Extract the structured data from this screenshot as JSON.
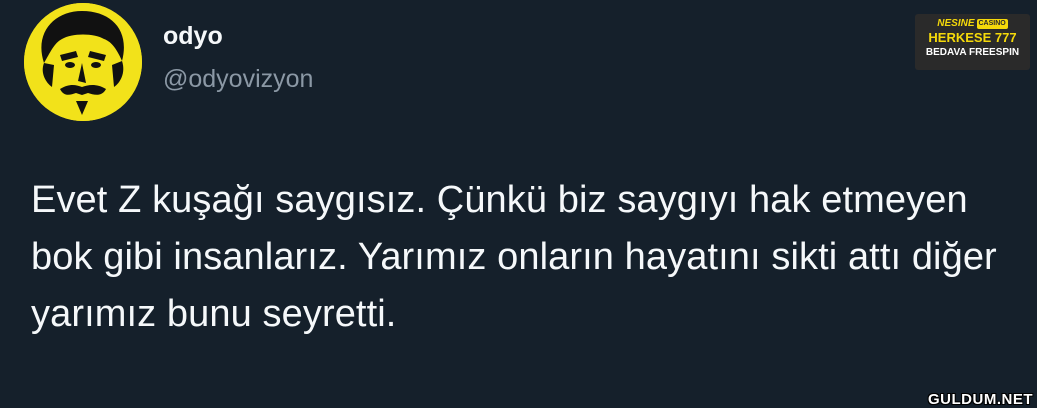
{
  "tweet": {
    "author_name": "odyo",
    "author_handle": "@odyovizyon",
    "text": "Evet Z kuşağı saygısız. Çünkü biz saygıyı hak etmeyen bok gibi insanlarız. Yarımız onların hayatını sikti attı diğer yarımız bunu seyretti."
  },
  "ad": {
    "brand": "NESINE",
    "badge": "CASINO",
    "line1": "HERKESE 777",
    "line2": "BEDAVA FREESPIN",
    "accent_color": "#f5d90a"
  },
  "watermark": "GULDUM.NET",
  "colors": {
    "background": "#15202b",
    "text": "#f5f8fa",
    "handle": "#8b98a5",
    "avatar_bg": "#f2e21a"
  }
}
